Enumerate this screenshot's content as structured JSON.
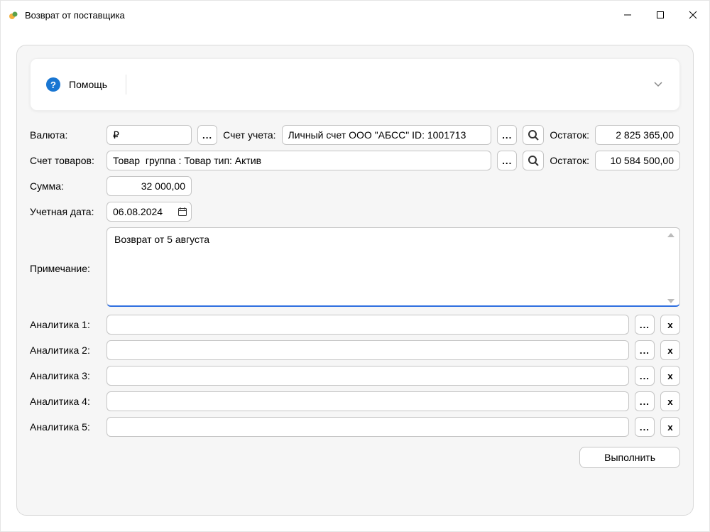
{
  "window": {
    "title": "Возврат от поставщика"
  },
  "help": {
    "label": "Помощь"
  },
  "labels": {
    "currency": "Валюта:",
    "account": "Счет учета:",
    "balance": "Остаток:",
    "goods_account": "Счет товаров:",
    "sum": "Сумма:",
    "acc_date": "Учетная дата:",
    "note": "Примечание:",
    "analytics1": "Аналитика 1:",
    "analytics2": "Аналитика 2:",
    "analytics3": "Аналитика 3:",
    "analytics4": "Аналитика 4:",
    "analytics5": "Аналитика 5:"
  },
  "fields": {
    "currency": "₽",
    "account": "Личный счет ООО \"АБСС\" ID: 1001713",
    "balance1": "2 825 365,00",
    "goods_account": "Товар  группа : Товар тип: Актив",
    "balance2": "10 584 500,00",
    "sum": "32 000,00",
    "acc_date": "06.08.2024",
    "note": "Возврат от 5 августа",
    "analytics1": "",
    "analytics2": "",
    "analytics3": "",
    "analytics4": "",
    "analytics5": ""
  },
  "buttons": {
    "ellipsis": "...",
    "x": "х",
    "execute": "Выполнить"
  }
}
